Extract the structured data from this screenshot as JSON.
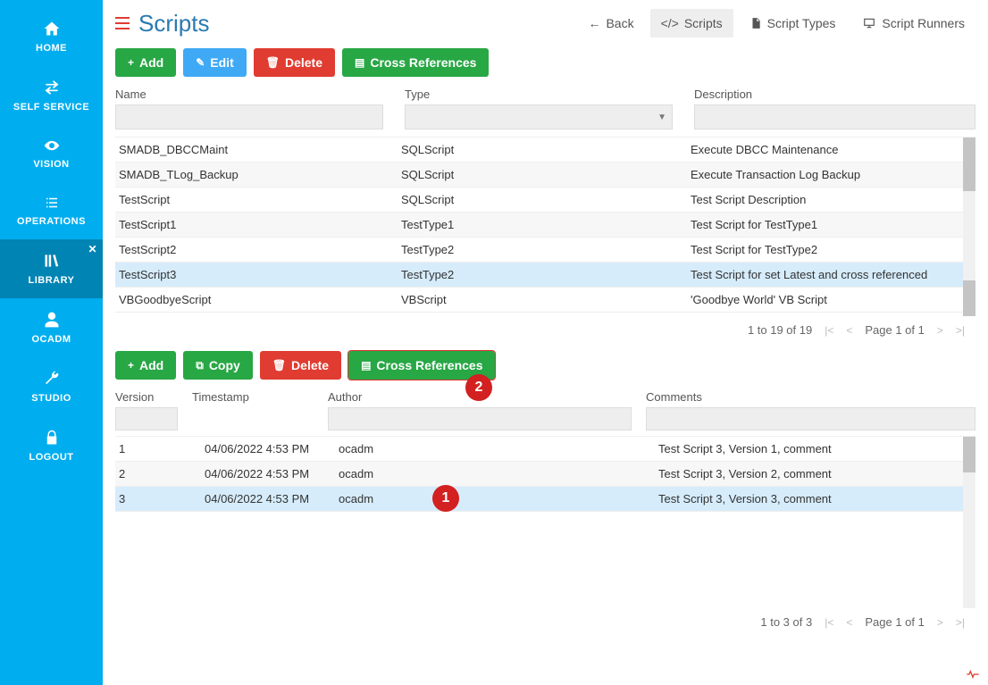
{
  "sidebar": {
    "items": [
      {
        "label": "HOME"
      },
      {
        "label": "SELF SERVICE"
      },
      {
        "label": "VISION"
      },
      {
        "label": "OPERATIONS"
      },
      {
        "label": "LIBRARY"
      },
      {
        "label": "OCADM"
      },
      {
        "label": "STUDIO"
      },
      {
        "label": "LOGOUT"
      }
    ]
  },
  "header": {
    "title": "Scripts",
    "nav": {
      "back": "Back",
      "scripts": "Scripts",
      "types": "Script Types",
      "runners": "Script Runners"
    }
  },
  "topToolbar": {
    "add": "Add",
    "edit": "Edit",
    "delete": "Delete",
    "cross": "Cross References"
  },
  "filters": {
    "name": "Name",
    "type": "Type",
    "desc": "Description"
  },
  "scripts": {
    "rows": [
      {
        "name": "SMADB_DBCCMaint",
        "type": "SQLScript",
        "desc": "Execute DBCC Maintenance"
      },
      {
        "name": "SMADB_TLog_Backup",
        "type": "SQLScript",
        "desc": "Execute Transaction Log Backup"
      },
      {
        "name": "TestScript",
        "type": "SQLScript",
        "desc": "Test Script Description"
      },
      {
        "name": "TestScript1",
        "type": "TestType1",
        "desc": "Test Script for TestType1"
      },
      {
        "name": "TestScript2",
        "type": "TestType2",
        "desc": "Test Script for TestType2"
      },
      {
        "name": "TestScript3",
        "type": "TestType2",
        "desc": "Test Script for set Latest and cross referenced"
      },
      {
        "name": "VBGoodbyeScript",
        "type": "VBScript",
        "desc": "'Goodbye World' VB Script"
      }
    ],
    "pager": {
      "range": "1 to 19 of 19",
      "page": "Page 1 of 1"
    }
  },
  "subToolbar": {
    "add": "Add",
    "copy": "Copy",
    "delete": "Delete",
    "cross": "Cross References"
  },
  "markers": {
    "one": "1",
    "two": "2"
  },
  "subFilters": {
    "version": "Version",
    "timestamp": "Timestamp",
    "author": "Author",
    "comments": "Comments"
  },
  "versions": {
    "rows": [
      {
        "ver": "1",
        "ts": "04/06/2022 4:53 PM",
        "author": "ocadm",
        "comments": "Test Script 3, Version 1, comment"
      },
      {
        "ver": "2",
        "ts": "04/06/2022 4:53 PM",
        "author": "ocadm",
        "comments": "Test Script 3, Version 2, comment"
      },
      {
        "ver": "3",
        "ts": "04/06/2022 4:53 PM",
        "author": "ocadm",
        "comments": "Test Script 3, Version 3, comment"
      }
    ],
    "pager": {
      "range": "1 to 3 of 3",
      "page": "Page 1 of 1"
    }
  }
}
